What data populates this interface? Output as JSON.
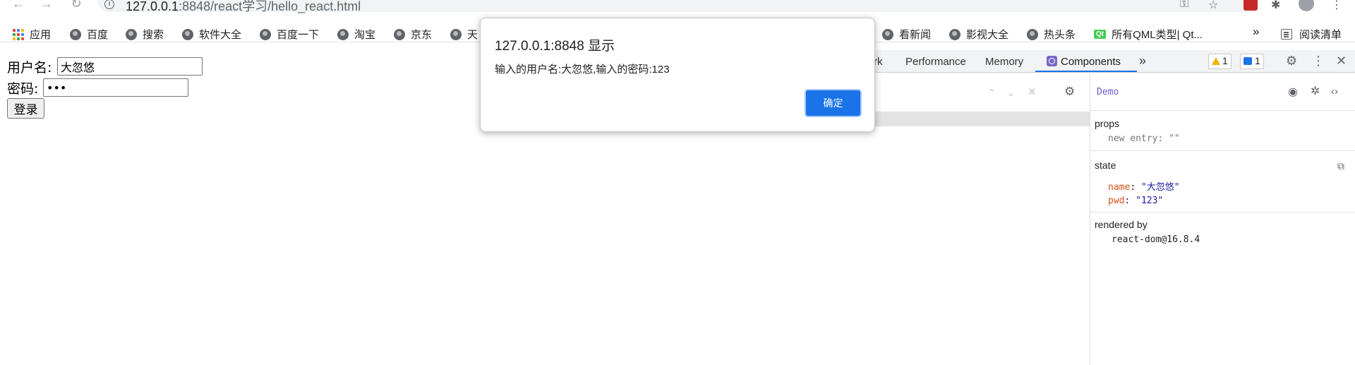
{
  "browser": {
    "url_host": "127.0.0.1",
    "url_rest": ":8848/react学习/hello_react.html",
    "bookmarks": [
      "应用",
      "百度",
      "搜索",
      "软件大全",
      "百度一下",
      "淘宝",
      "京东",
      "天",
      "看新闻",
      "影视大全",
      "热头条",
      "所有QML类型| Qt...",
      "阅读清单"
    ],
    "more_label": "»"
  },
  "page": {
    "username_label": "用户名:",
    "username_value": "大忽悠",
    "password_label": "密码:",
    "password_value": "123",
    "login_button": "登录"
  },
  "alert": {
    "title": "127.0.0.1:8848 显示",
    "message": "输入的用户名:大忽悠,输入的密码:123",
    "ok_label": "确定"
  },
  "devtools": {
    "tabs": [
      "rk",
      "Performance",
      "Memory",
      "Components"
    ],
    "active_tab": "Components",
    "more_tabs": "»",
    "warnings_count": "1",
    "messages_count": "1",
    "selected_component": "Demo",
    "props_title": "props",
    "props": [
      {
        "key": "new entry",
        "value": "\"\""
      }
    ],
    "state_title": "state",
    "state": [
      {
        "key": "name",
        "value": "\"大忽悠\""
      },
      {
        "key": "pwd",
        "value": "\"123\""
      }
    ],
    "rendered_by_title": "rendered by",
    "rendered_by_value": "react-dom@16.8.4"
  },
  "colors": {
    "accent": "#1a73e8",
    "react_purple": "#7b67c9",
    "state_key": "#d4531a",
    "string_value": "#1a1aa6"
  }
}
